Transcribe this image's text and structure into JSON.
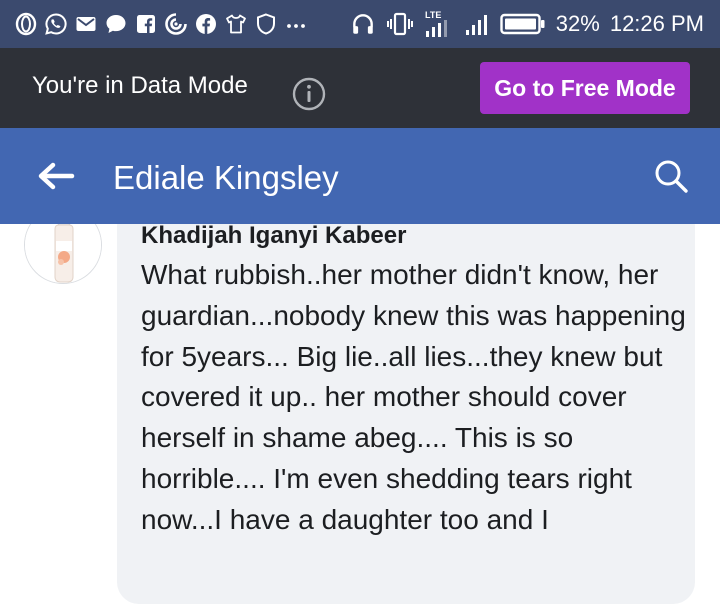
{
  "status_bar": {
    "battery_percent_text": "32%",
    "time": "12:26 PM",
    "network_label": "LTE",
    "left_icons": [
      "opera-icon",
      "whatsapp-icon",
      "mail-icon",
      "chat-bubble-icon",
      "facebook-icon",
      "opera-mini-icon",
      "facebook-circle-icon",
      "shirt-icon",
      "shield-icon",
      "more-icon"
    ],
    "right_icons": [
      "headphones-icon",
      "vibrate-icon",
      "signal-icon",
      "signal-icon",
      "battery-icon"
    ]
  },
  "data_mode": {
    "message": "You're in Data Mode",
    "button_label": "Go to Free Mode",
    "button_color": "#a132c8"
  },
  "header": {
    "title": "Ediale Kingsley",
    "color": "#4267b2"
  },
  "comment": {
    "author": "Khadijah Iganyi Kabeer",
    "text": "What rubbish..her mother didn't know, her guardian...nobody knew this was happening for 5years... Big lie..all lies...they knew but covered it up..  her mother should cover herself in shame abeg.... This is so horrible.... I'm even shedding tears right now...I have a daughter too and I"
  }
}
